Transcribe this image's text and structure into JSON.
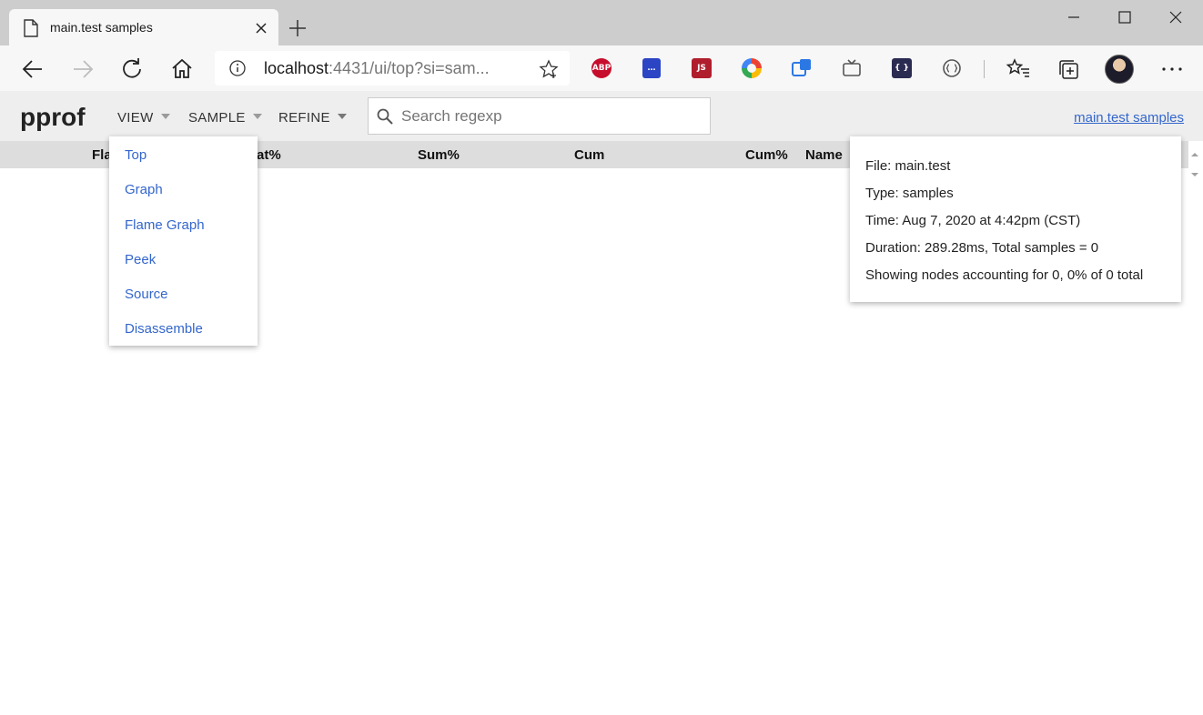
{
  "browser": {
    "tab_title": "main.test samples",
    "url_host": "localhost",
    "url_rest": ":4431/ui/top?si=sam...",
    "extensions": [
      {
        "name": "adblock-plus-icon",
        "label": "ABP",
        "color": "#c70d2c"
      },
      {
        "name": "extension-icon-2",
        "label": "…",
        "color": "#2b45c4"
      },
      {
        "name": "js-extension-icon",
        "label": "JS",
        "color": "#b01e2d"
      },
      {
        "name": "color-ring-icon",
        "label": "",
        "color": "#e8a317"
      },
      {
        "name": "extension-icon-5",
        "label": "",
        "color": "#2b78e4"
      },
      {
        "name": "tv-icon",
        "label": "",
        "color": "#555555"
      },
      {
        "name": "code-braces-icon",
        "label": "{ }",
        "color": "#2b2b52"
      },
      {
        "name": "json-viewer-icon",
        "label": "",
        "color": "#555555"
      }
    ]
  },
  "app": {
    "logo": "pprof",
    "menus": {
      "view": "VIEW",
      "sample": "SAMPLE",
      "refine": "REFINE"
    },
    "search_placeholder": "Search regexp",
    "title_link": "main.test samples"
  },
  "table": {
    "columns": [
      "Fla",
      "at%",
      "Sum%",
      "Cum",
      "Cum%",
      "Name"
    ]
  },
  "view_menu": {
    "items": [
      "Top",
      "Graph",
      "Flame Graph",
      "Peek",
      "Source",
      "Disassemble"
    ]
  },
  "details": {
    "lines": [
      "File: main.test",
      "Type: samples",
      "Time: Aug 7, 2020 at 4:42pm (CST)",
      "Duration: 289.28ms, Total samples = 0",
      "Showing nodes accounting for 0, 0% of 0 total"
    ]
  },
  "colors": {
    "link": "#3366cc",
    "header_bg": "#eeeeee",
    "table_head_bg": "#dddddd"
  }
}
